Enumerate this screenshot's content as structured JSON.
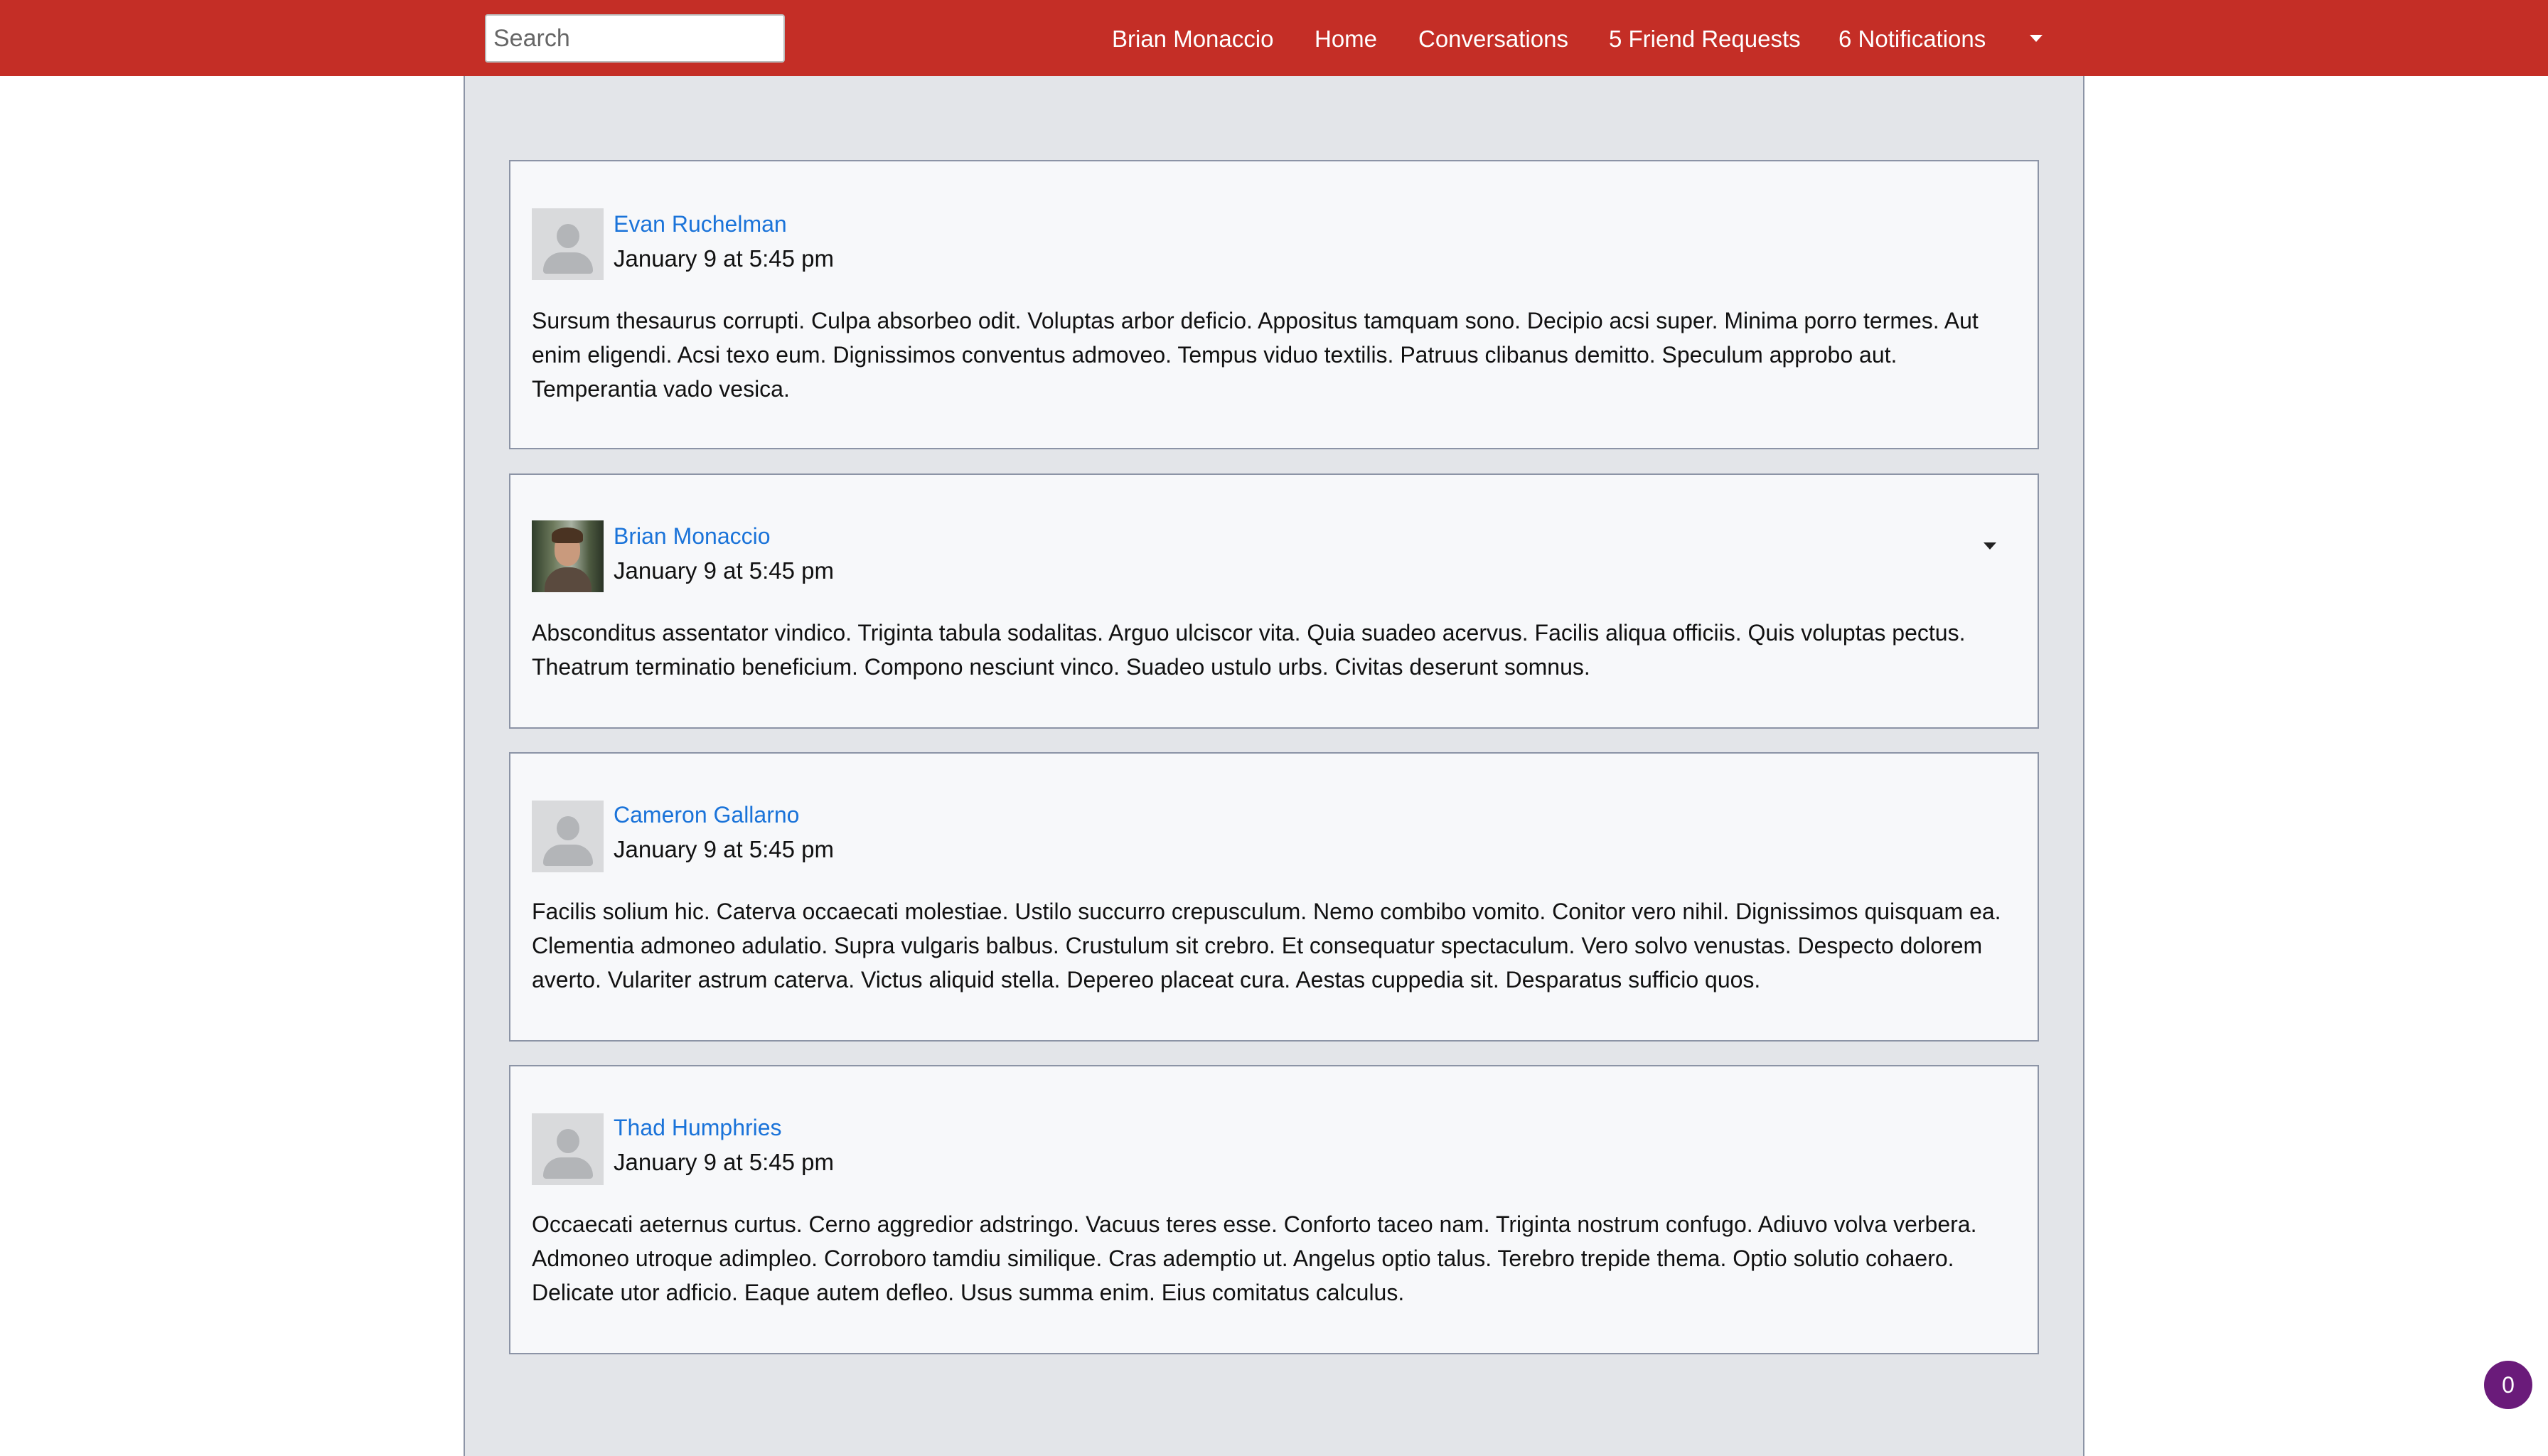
{
  "nav": {
    "search_placeholder": "Search",
    "user_name": "Brian Monaccio",
    "home": "Home",
    "conversations": "Conversations",
    "friend_requests": "5 Friend Requests",
    "notifications": "6 Notifications"
  },
  "posts": [
    {
      "author": "Evan Ruchelman",
      "timestamp": "January 9 at 5:45 pm",
      "avatar": "default-avatar",
      "body": "Sursum thesaurus corrupti. Culpa absorbeo odit. Voluptas arbor deficio. Appositus tamquam sono. Decipio acsi super. Minima porro termes. Aut enim eligendi. Acsi texo eum. Dignissimos conventus admoveo. Tempus viduo textilis. Patruus clibanus demitto. Speculum approbo aut. Temperantia vado vesica."
    },
    {
      "author": "Brian Monaccio",
      "timestamp": "January 9 at 5:45 pm",
      "avatar": "photo-avatar",
      "body": "Absconditus assentator vindico. Triginta tabula sodalitas. Arguo ulciscor vita. Quia suadeo acervus. Facilis aliqua officiis. Quis voluptas pectus. Theatrum terminatio beneficium. Compono nesciunt vinco. Suadeo ustulo urbs. Civitas deserunt somnus."
    },
    {
      "author": "Cameron Gallarno",
      "timestamp": "January 9 at 5:45 pm",
      "avatar": "default-avatar",
      "body": "Facilis solium hic. Caterva occaecati molestiae. Ustilo succurro crepusculum. Nemo combibo vomito. Conitor vero nihil. Dignissimos quisquam ea. Clementia admoneo adulatio. Supra vulgaris balbus. Crustulum sit crebro. Et consequatur spectaculum. Vero solvo venustas. Despecto dolorem averto. Vulariter astrum caterva. Victus aliquid stella. Depereo placeat cura. Aestas cuppedia sit. Desparatus sufficio quos."
    },
    {
      "author": "Thad Humphries",
      "timestamp": "January 9 at 5:45 pm",
      "avatar": "default-avatar",
      "body": "Occaecati aeternus curtus. Cerno aggredior adstringo. Vacuus teres esse. Conforto taceo nam. Triginta nostrum confugo. Adiuvo volva verbera. Admoneo utroque adimpleo. Corroboro tamdiu similique. Cras ademptio ut. Angelus optio talus. Terebro trepide thema. Optio solutio cohaero. Delicate utor adficio. Eaque autem defleo. Usus summa enim. Eius comitatus calculus."
    }
  ],
  "chat_badge": {
    "count": "0"
  },
  "colors": {
    "nav_bg": "#c42e26",
    "link": "#1a73d9",
    "feed_bg": "#e3e5e9",
    "badge": "#6a1b7a"
  }
}
